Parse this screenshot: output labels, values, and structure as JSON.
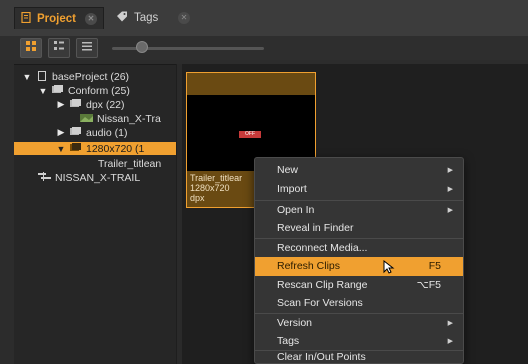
{
  "tabs": [
    {
      "label": "Project",
      "icon": "project-icon",
      "active": true
    },
    {
      "label": "Tags",
      "icon": "tags-icon",
      "active": false
    }
  ],
  "toolbar": {
    "view_modes": [
      "grid-view-icon",
      "detail-view-icon",
      "list-view-icon"
    ],
    "thumbnail_size_level": 0.2
  },
  "tree": [
    {
      "label": "baseProject (26)",
      "expanded": true,
      "icon": "project-icon"
    },
    {
      "label": "Conform (25)",
      "expanded": true,
      "icon": "bin-icon"
    },
    {
      "label": "dpx (22)",
      "expanded": false,
      "icon": "bin-icon"
    },
    {
      "label": "Nissan_X-Tra",
      "icon": "clip-icon"
    },
    {
      "label": "audio (1)",
      "expanded": false,
      "icon": "bin-icon"
    },
    {
      "label": "1280x720 (1",
      "expanded": true,
      "icon": "bin-icon",
      "selected": true
    },
    {
      "label": "Trailer_titlean",
      "icon": "clip-icon"
    },
    {
      "label": "NISSAN_X-TRAIL",
      "icon": "timeline-icon"
    }
  ],
  "clip": {
    "name": "Trailer_titlear",
    "resolution": "1280x720",
    "format": "dpx",
    "badge": "OFF"
  },
  "context_menu": {
    "items": [
      {
        "label": "New",
        "submenu": true
      },
      {
        "label": "Import",
        "submenu": true
      },
      {
        "label": "Open In",
        "submenu": true
      },
      {
        "label": "Reveal in Finder"
      },
      {
        "label": "Reconnect Media..."
      },
      {
        "label": "Refresh Clips",
        "shortcut": "F5",
        "highlighted": true
      },
      {
        "label": "Rescan Clip Range",
        "shortcut": "⌥F5"
      },
      {
        "label": "Scan For Versions"
      },
      {
        "label": "Version",
        "submenu": true
      },
      {
        "label": "Tags",
        "submenu": true
      },
      {
        "label": "Clear In/Out Points"
      }
    ]
  },
  "colors": {
    "accent": "#f0a030",
    "panel": "#262626",
    "menu": "#353535"
  }
}
